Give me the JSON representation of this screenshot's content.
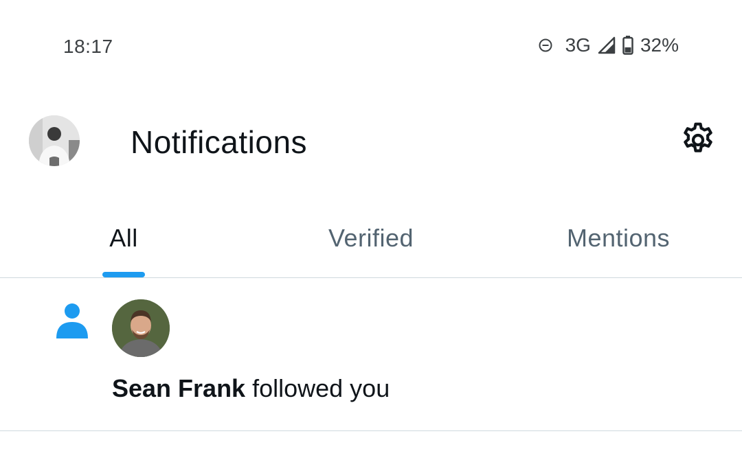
{
  "status_bar": {
    "time": "18:17",
    "network": "3G",
    "battery": "32%",
    "icons": [
      "do-not-disturb-icon",
      "signal-icon",
      "battery-icon"
    ]
  },
  "header": {
    "title": "Notifications",
    "avatar_icon": "profile-avatar",
    "settings_icon": "gear-icon"
  },
  "tabs": [
    {
      "label": "All",
      "active": true
    },
    {
      "label": "Verified",
      "active": false
    },
    {
      "label": "Mentions",
      "active": false
    }
  ],
  "notifications": [
    {
      "icon": "person-icon",
      "user_name": "Sean Frank",
      "action": " followed you"
    }
  ],
  "colors": {
    "accent": "#1d9bf0",
    "text_primary": "#0f1419",
    "text_secondary": "#536471",
    "divider": "#cfd9de"
  }
}
